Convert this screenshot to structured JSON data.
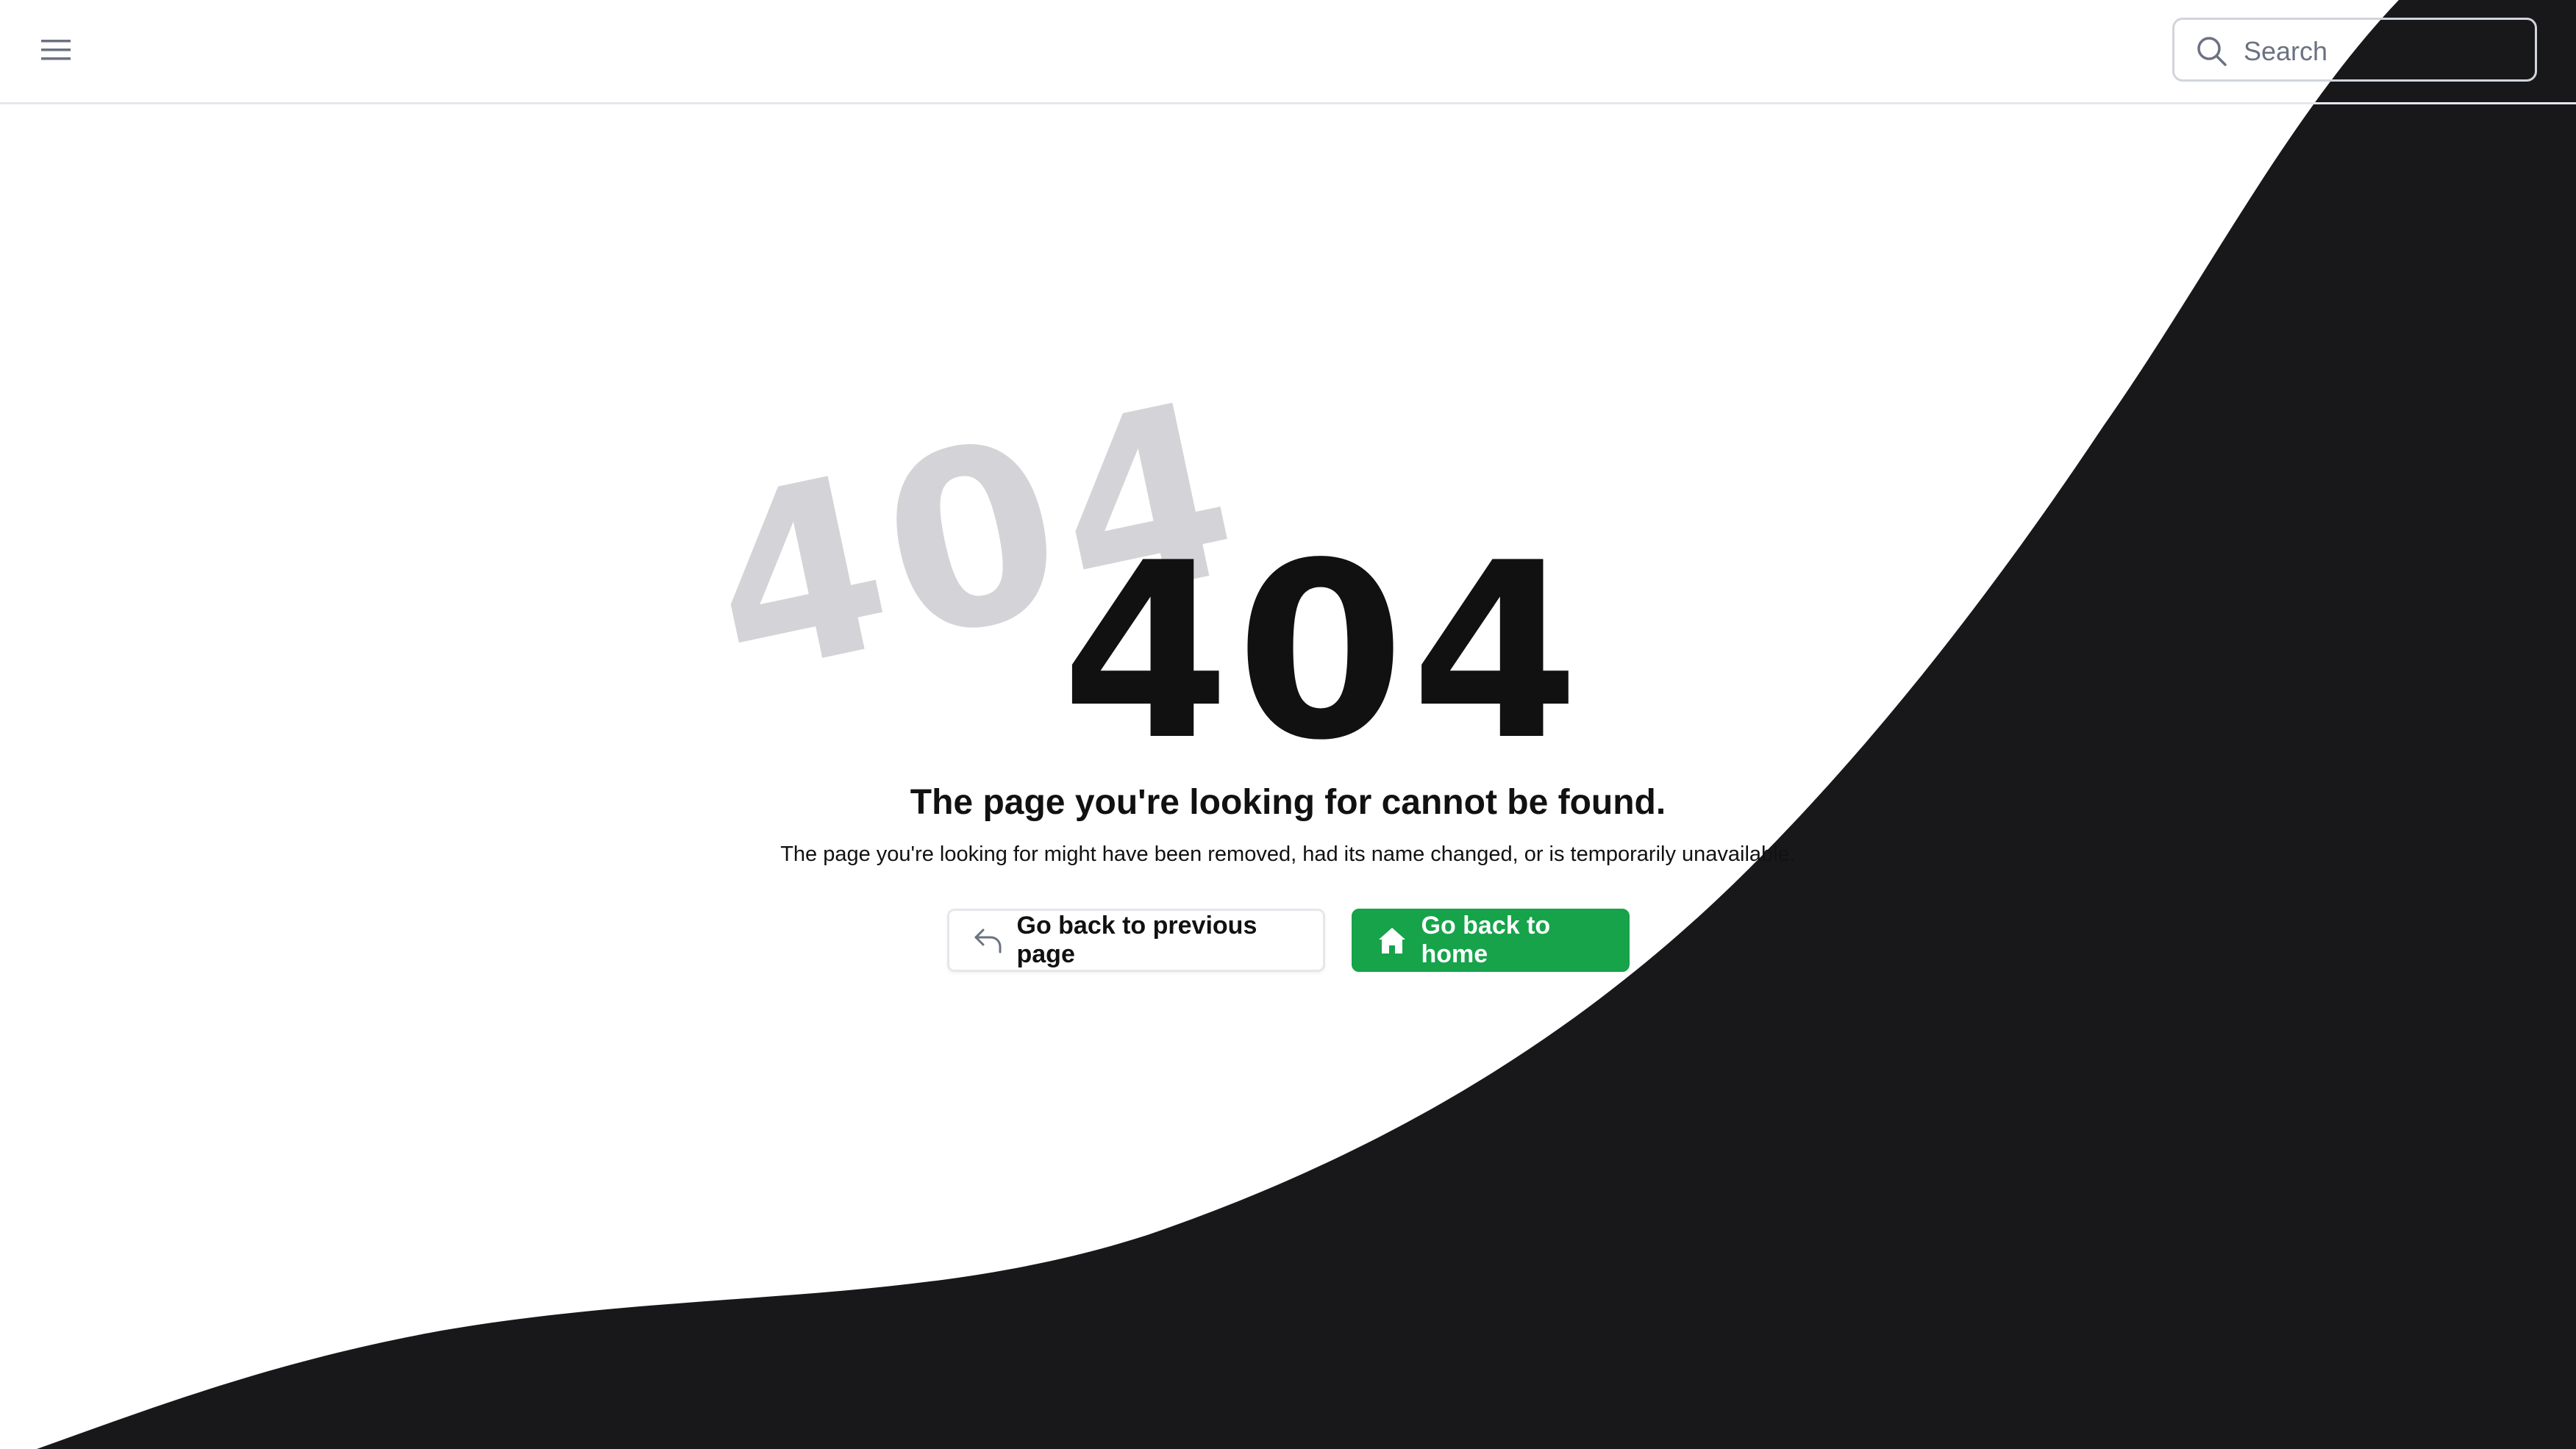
{
  "header": {
    "menu_icon": "hamburger-menu-icon",
    "search": {
      "placeholder": "Search",
      "value": "",
      "icon": "search-icon"
    }
  },
  "error": {
    "ghost_code": "404",
    "code": "404",
    "title": "The page you're looking for cannot be found.",
    "description": "The page you're looking for might have been removed, had its name changed, or is temporarily unavailable."
  },
  "actions": {
    "back_label": "Go back to previous page",
    "back_icon": "undo-arrow-icon",
    "home_label": "Go back to home",
    "home_icon": "home-icon"
  },
  "colors": {
    "background": "#ffffff",
    "wave": "#18181b",
    "primary": "#16a34a",
    "text": "#111111",
    "ghost_text": "#d4d4d8"
  }
}
